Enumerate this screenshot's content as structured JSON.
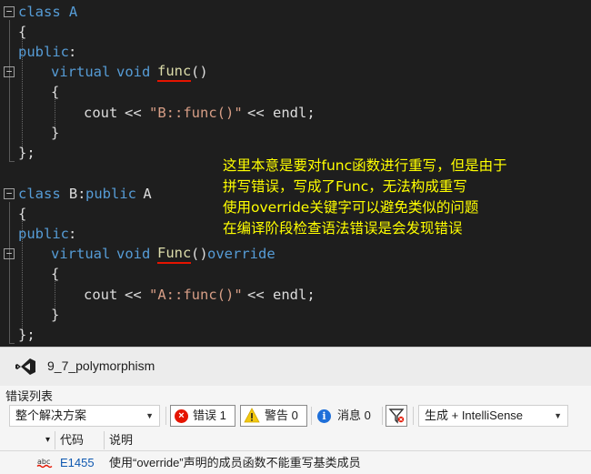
{
  "editor": {
    "classA": {
      "kw_class": "class",
      "name": " A",
      "open_brace": "{",
      "access": "public",
      "colon": ":",
      "kw_virtual": "virtual",
      "kw_void": "void",
      "func_name": "func",
      "parens": "()",
      "body_open": "{",
      "cout": "cout",
      "op1": "<<",
      "string": "\"B::func()\"",
      "op2": "<<",
      "endl": "endl;",
      "body_close": "}",
      "close": "};"
    },
    "classB": {
      "kw_class": "class",
      "name": " B:",
      "kw_public": "public",
      "base": " A",
      "open_brace": "{",
      "access": "public",
      "colon": ":",
      "kw_virtual": "virtual",
      "kw_void": "void",
      "func_name": "Func",
      "parens": "()",
      "kw_override": "override",
      "body_open": "{",
      "cout": "cout",
      "op1": "<<",
      "string": "\"A::func()\"",
      "op2": "<<",
      "endl": "endl;",
      "body_close": "}",
      "close": "};"
    },
    "annotation": [
      "这里本意是要对func函数进行重写，但是由于",
      "拼写错误，写成了Func，无法构成重写",
      "使用override关键字可以避免类似的问题",
      "在编译阶段检查语法错误是会发现错误"
    ],
    "colors": {
      "keyword": "#569cd6",
      "function": "#dcdcaa",
      "string": "#d69d85",
      "annotation": "#ffff00",
      "error_squiggle": "#e51400"
    }
  },
  "panel": {
    "solution_name": "9_7_polymorphism",
    "title": "错误列表",
    "scope_select": "整个解决方案",
    "errors_label": "错误 1",
    "warnings_label": "警告 0",
    "messages_label": "消息 0",
    "build_select": "生成 + IntelliSense",
    "columns": {
      "code": "代码",
      "description": "说明"
    },
    "rows": [
      {
        "code": "E1455",
        "description": "使用“override”声明的成员函数不能重写基类成员"
      }
    ]
  }
}
